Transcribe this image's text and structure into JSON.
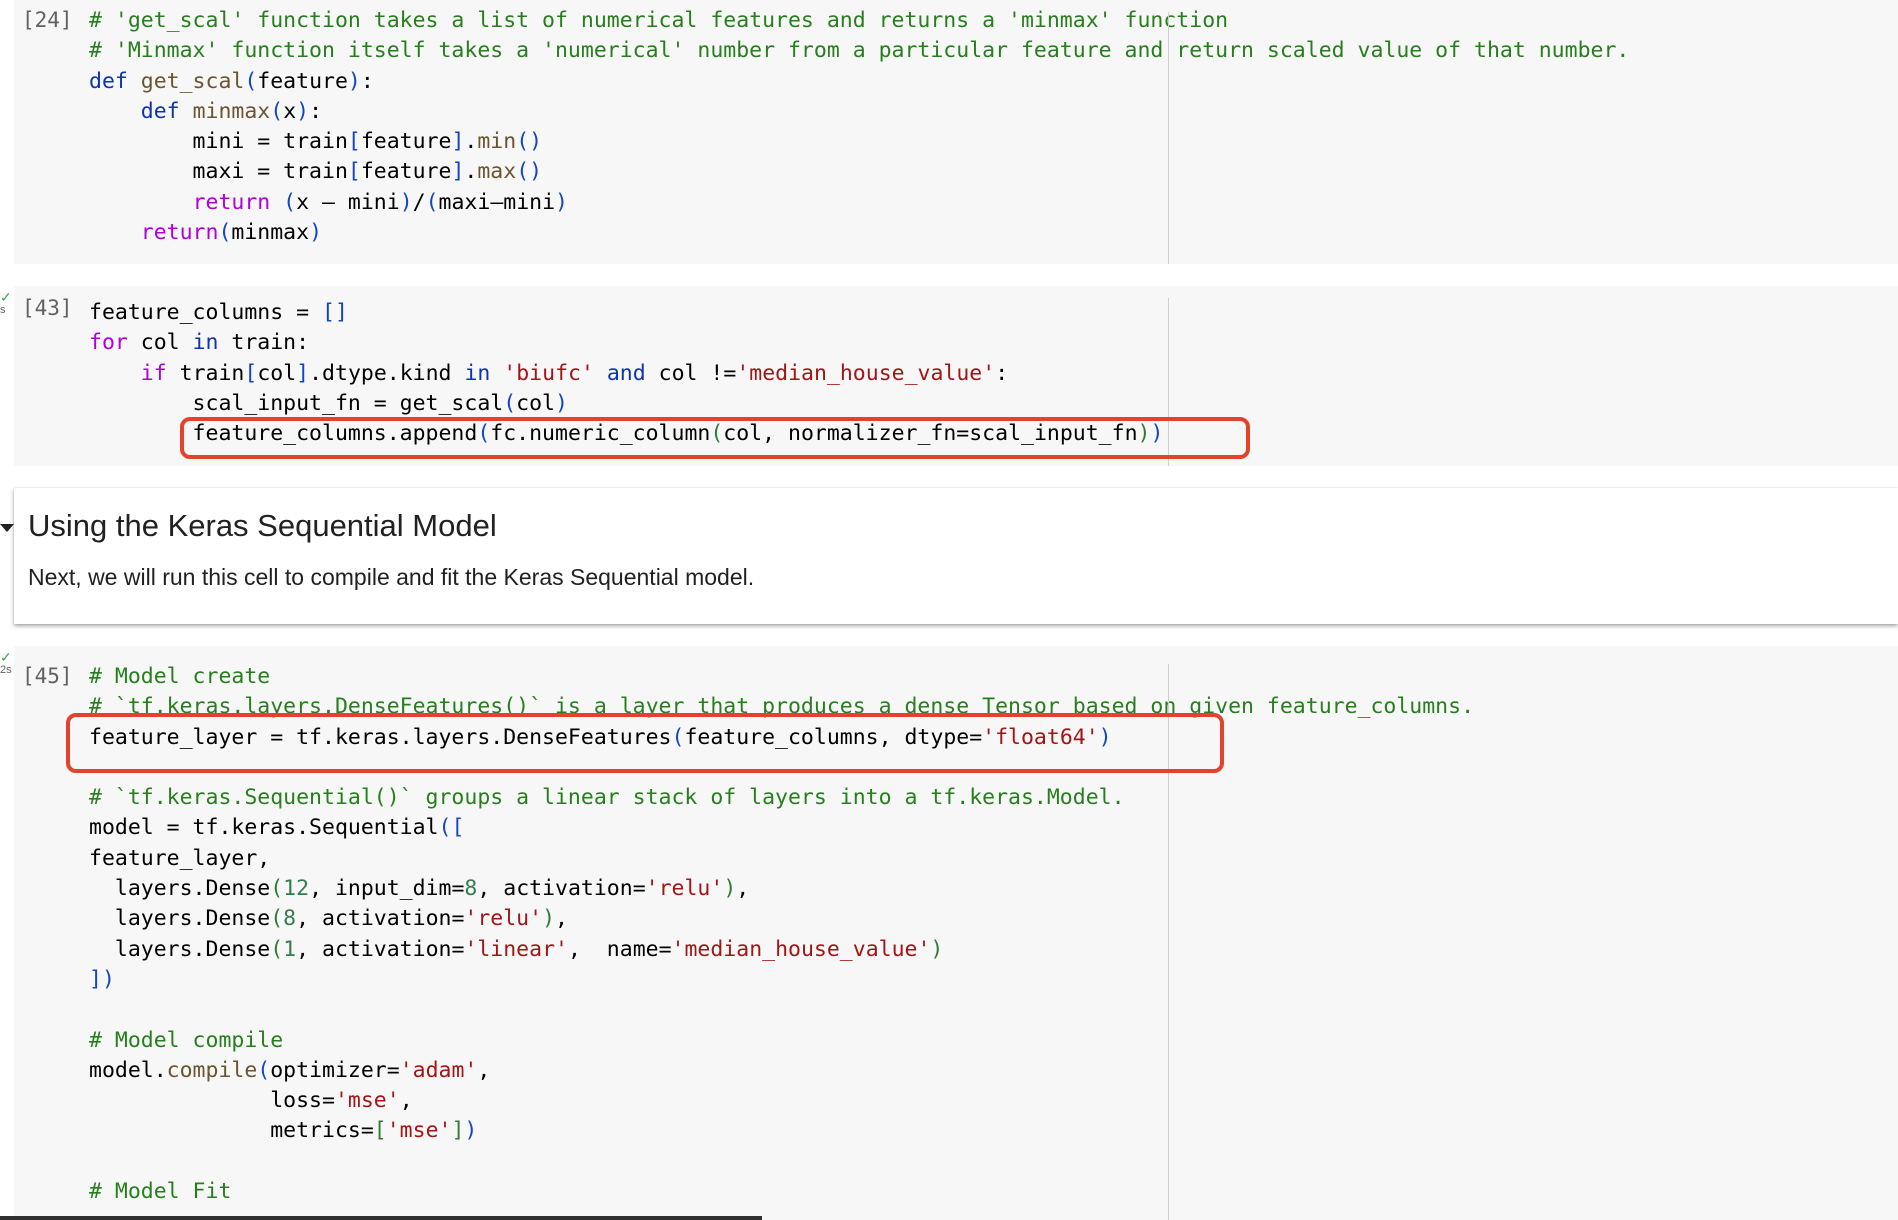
{
  "cells": [
    {
      "exec_count": "[24]",
      "status": null,
      "lines": [
        [
          [
            "c",
            "# 'get_scal' function takes a list of numerical features and returns a 'minmax' function"
          ]
        ],
        [
          [
            "c",
            "# 'Minmax' function itself takes a 'numerical' number from a particular feature and return scaled value of that number."
          ]
        ],
        [
          [
            "k",
            "def "
          ],
          [
            "f",
            "get_scal"
          ],
          [
            "b",
            "("
          ],
          [
            "t",
            "feature"
          ],
          [
            "b",
            ")"
          ],
          [
            "t",
            ":"
          ]
        ],
        [
          [
            "t",
            "    "
          ],
          [
            "k",
            "def "
          ],
          [
            "f",
            "minmax"
          ],
          [
            "b",
            "("
          ],
          [
            "t",
            "x"
          ],
          [
            "b",
            ")"
          ],
          [
            "t",
            ":"
          ]
        ],
        [
          [
            "t",
            "        mini = train"
          ],
          [
            "b",
            "["
          ],
          [
            "t",
            "feature"
          ],
          [
            "b",
            "]"
          ],
          [
            "t",
            "."
          ],
          [
            "f",
            "min"
          ],
          [
            "b",
            "()"
          ]
        ],
        [
          [
            "t",
            "        maxi = train"
          ],
          [
            "b",
            "["
          ],
          [
            "t",
            "feature"
          ],
          [
            "b",
            "]"
          ],
          [
            "t",
            "."
          ],
          [
            "f",
            "max"
          ],
          [
            "b",
            "()"
          ]
        ],
        [
          [
            "t",
            "        "
          ],
          [
            "p",
            "return "
          ],
          [
            "b",
            "("
          ],
          [
            "t",
            "x – mini"
          ],
          [
            "b",
            ")"
          ],
          [
            "t",
            "/"
          ],
          [
            "b",
            "("
          ],
          [
            "t",
            "maxi–mini"
          ],
          [
            "b",
            ")"
          ]
        ],
        [
          [
            "t",
            "    "
          ],
          [
            "p",
            "return"
          ],
          [
            "b",
            "("
          ],
          [
            "t",
            "minmax"
          ],
          [
            "b",
            ")"
          ]
        ]
      ]
    },
    {
      "exec_count": "[43]",
      "status": {
        "icon": "check-icon",
        "time": "s"
      },
      "lines": [
        [
          [
            "t",
            "feature_columns = "
          ],
          [
            "b",
            "[]"
          ]
        ],
        [
          [
            "p",
            "for "
          ],
          [
            "t",
            "col "
          ],
          [
            "k",
            "in "
          ],
          [
            "t",
            "train:"
          ]
        ],
        [
          [
            "t",
            "    "
          ],
          [
            "p",
            "if "
          ],
          [
            "t",
            "train"
          ],
          [
            "b",
            "["
          ],
          [
            "t",
            "col"
          ],
          [
            "b",
            "]"
          ],
          [
            "t",
            ".dtype.kind "
          ],
          [
            "k",
            "in "
          ],
          [
            "s",
            "'biufc'"
          ],
          [
            "k",
            " and "
          ],
          [
            "t",
            "col !="
          ],
          [
            "s",
            "'median_house_value'"
          ],
          [
            "t",
            ":"
          ]
        ],
        [
          [
            "t",
            "        scal_input_fn = get_scal"
          ],
          [
            "b",
            "("
          ],
          [
            "t",
            "col"
          ],
          [
            "b",
            ")"
          ]
        ],
        [
          [
            "t",
            "        feature_columns.append"
          ],
          [
            "b",
            "("
          ],
          [
            "t",
            "fc.numeric_column"
          ],
          [
            "g",
            "("
          ],
          [
            "t",
            "col, normalizer_fn=scal_input_fn"
          ],
          [
            "g",
            ")"
          ],
          [
            "b",
            ")"
          ]
        ]
      ]
    },
    {
      "exec_count": "[45]",
      "status": {
        "icon": "check-icon",
        "time": "2s"
      },
      "lines": [
        [
          [
            "c",
            "# Model create"
          ]
        ],
        [
          [
            "c",
            "# `tf.keras.layers.DenseFeatures()` is a layer that produces a dense Tensor based on given feature_columns."
          ]
        ],
        [
          [
            "t",
            "feature_layer = tf.keras.layers.DenseFeatures"
          ],
          [
            "b",
            "("
          ],
          [
            "t",
            "feature_columns, dtype="
          ],
          [
            "s",
            "'float64'"
          ],
          [
            "b",
            ")"
          ]
        ],
        [],
        [
          [
            "c",
            "# `tf.keras.Sequential()` groups a linear stack of layers into a tf.keras.Model."
          ]
        ],
        [
          [
            "t",
            "model = tf.keras.Sequential"
          ],
          [
            "b",
            "(["
          ]
        ],
        [
          [
            "t",
            "feature_layer,"
          ]
        ],
        [
          [
            "t",
            "  layers.Dense"
          ],
          [
            "g",
            "("
          ],
          [
            "n",
            "12"
          ],
          [
            "t",
            ", input_dim="
          ],
          [
            "n",
            "8"
          ],
          [
            "t",
            ", activation="
          ],
          [
            "s",
            "'relu'"
          ],
          [
            "g",
            ")"
          ],
          [
            "t",
            ","
          ]
        ],
        [
          [
            "t",
            "  layers.Dense"
          ],
          [
            "g",
            "("
          ],
          [
            "n",
            "8"
          ],
          [
            "t",
            ", activation="
          ],
          [
            "s",
            "'relu'"
          ],
          [
            "g",
            ")"
          ],
          [
            "t",
            ","
          ]
        ],
        [
          [
            "t",
            "  layers.Dense"
          ],
          [
            "g",
            "("
          ],
          [
            "n",
            "1"
          ],
          [
            "t",
            ", activation="
          ],
          [
            "s",
            "'linear'"
          ],
          [
            "t",
            ",  name="
          ],
          [
            "s",
            "'median_house_value'"
          ],
          [
            "g",
            ")"
          ]
        ],
        [
          [
            "b",
            "])"
          ]
        ],
        [],
        [
          [
            "c",
            "# Model compile"
          ]
        ],
        [
          [
            "t",
            "model."
          ],
          [
            "f",
            "compile"
          ],
          [
            "b",
            "("
          ],
          [
            "t",
            "optimizer="
          ],
          [
            "s",
            "'adam'"
          ],
          [
            "t",
            ","
          ]
        ],
        [
          [
            "t",
            "              loss="
          ],
          [
            "s",
            "'mse'"
          ],
          [
            "t",
            ","
          ]
        ],
        [
          [
            "t",
            "              metrics="
          ],
          [
            "g",
            "["
          ],
          [
            "s",
            "'mse'"
          ],
          [
            "g",
            "]"
          ],
          [
            "b",
            ")"
          ]
        ],
        [],
        [
          [
            "c",
            "# Model Fit"
          ]
        ]
      ]
    }
  ],
  "markdown": {
    "heading": "Using the Keras Sequential Model",
    "body": "Next, we will run this cell to compile and fit the Keras Sequential model.",
    "collapse_icon": "triangle-down-icon"
  },
  "annotations": {
    "highlight_color": "#e2432a",
    "highlights": [
      "feature_columns.append line",
      "feature_layer line"
    ]
  }
}
